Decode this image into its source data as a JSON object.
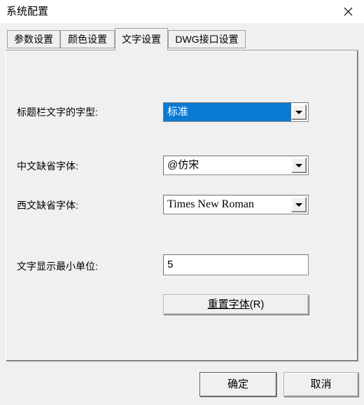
{
  "window": {
    "title": "系统配置",
    "close_icon": "close-icon"
  },
  "tabs": [
    {
      "label": "参数设置",
      "active": false
    },
    {
      "label": "颜色设置",
      "active": false
    },
    {
      "label": "文字设置",
      "active": true
    },
    {
      "label": "DWG接口设置",
      "active": false
    }
  ],
  "fields": {
    "title_font": {
      "label": "标题栏文字的字型:",
      "value": "标准",
      "selected": true,
      "arrow_icon": "chevron-down-icon"
    },
    "chinese_font": {
      "label": "中文缺省字体:",
      "value": "@仿宋",
      "selected": false,
      "arrow_icon": "chevron-down-icon"
    },
    "western_font": {
      "label": "西文缺省字体:",
      "value": "Times New Roman",
      "selected": false,
      "arrow_icon": "chevron-down-icon"
    },
    "min_unit": {
      "label": "文字显示最小单位:",
      "value": "5"
    }
  },
  "buttons": {
    "reset_font_main": "重置字体",
    "reset_font_accel": "(R)",
    "ok": "确定",
    "cancel": "取消"
  },
  "colors": {
    "dialog_background": "#f0f0f0",
    "titlebar_background": "#ffffff",
    "selection_highlight": "#0a7ad4",
    "field_background": "#ffffff",
    "border": "#868686"
  }
}
